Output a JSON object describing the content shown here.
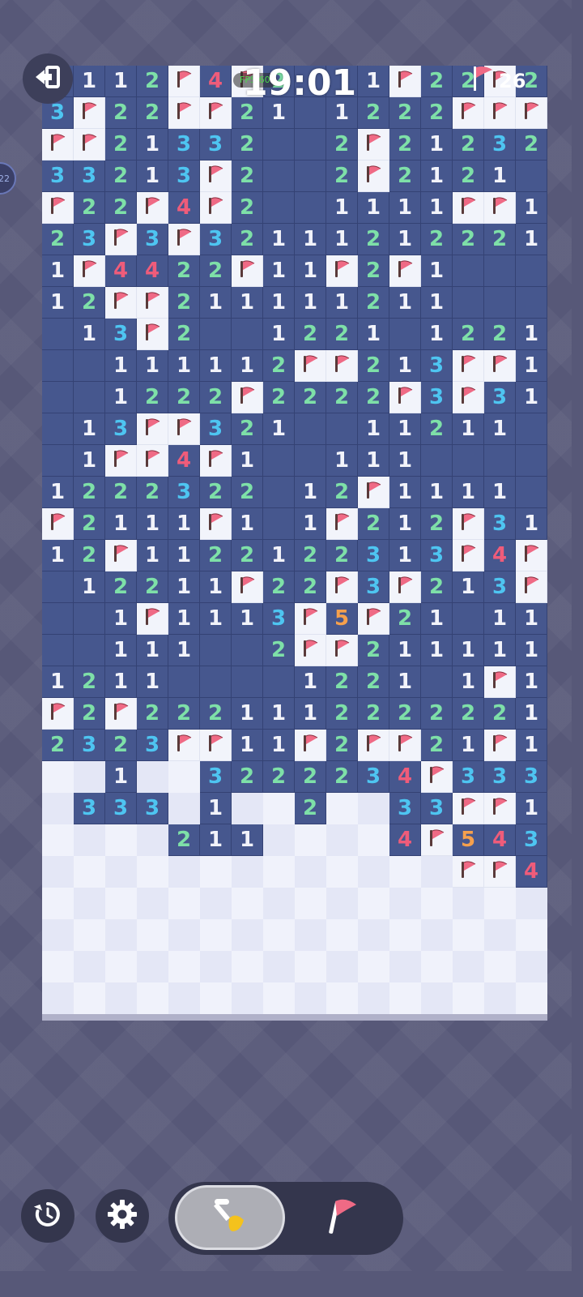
{
  "header": {
    "timer": "19:01",
    "fps_label": "FPS:60",
    "flags_remaining": "26",
    "side_badge": "22"
  },
  "toolbar": {
    "exit_icon": "exit-icon",
    "restart_icon": "restart-icon",
    "settings_icon": "gear-icon",
    "dig_mode_icon": "shovel-icon",
    "flag_mode_icon": "flag-icon",
    "active_mode": "dig"
  },
  "colors": {
    "open_cell": "#46578e",
    "flag_cell": "#f2f4fb",
    "hidden_light": "#f0f2fb",
    "hidden_dark": "#e4e7f6",
    "num_1": "#f2f3fa",
    "num_2": "#7ee0a8",
    "num_3": "#4ec5f1",
    "num_4": "#ef5c7a",
    "num_5": "#f6a04c",
    "flag_red": "#ef6a85"
  },
  "legend": "Each row string: '.' open empty, digit open number, 'F' flag, '#' unrevealed",
  "board": {
    "cols": 16,
    "rows": [
      ".112F4F2..1F22F2",
      "3F22FF21.1222FFF",
      "FF21332..2F2123 2",
      "3321 3F2..2F2121",
      "F22F4F2..1111FF1",
      "23F3F3211121 2221",
      "1F4422F11F2F1...",
      "12FF2111112 11...",
      ".13F2..1221.1221",
      "..11111 2FF213FF1",
      "..1222F2222F3F31",
      ".13FF321..1121 1.",
      ".1FF4F1..111....",
      "1222322.12F1111.",
      "F2111F1.1F212F31",
      "12F1122122313F4F",
      ".12211F22F3F213F",
      "..1F1113F5F21.11",
      "..111..2FF211111",
      "1211....1221.1F1",
      "F2F22211122222 21",
      "2323FF11F2FF21F1",
      "##1##3222234F3332",
      "#333#1##2##33FF1",
      "####211####4F543",
      "#############FF4FF",
      "################",
      "################",
      "################",
      "################"
    ]
  }
}
